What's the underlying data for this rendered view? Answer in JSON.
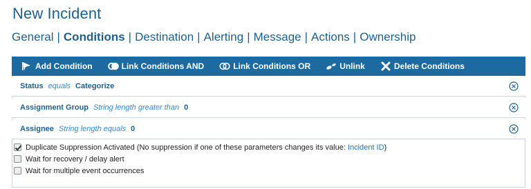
{
  "page": {
    "title": "New Incident"
  },
  "tabs": [
    {
      "label": "General",
      "active": false
    },
    {
      "label": "Conditions",
      "active": true
    },
    {
      "label": "Destination",
      "active": false
    },
    {
      "label": "Alerting",
      "active": false
    },
    {
      "label": "Message",
      "active": false
    },
    {
      "label": "Actions",
      "active": false
    },
    {
      "label": "Ownership",
      "active": false
    }
  ],
  "tab_separator": "|",
  "toolbar": {
    "add": {
      "label": "Add Condition",
      "icon": "flag-arrow-icon"
    },
    "link_and": {
      "label": "Link Conditions AND",
      "icon": "link-and-icon"
    },
    "link_or": {
      "label": "Link Conditions OR",
      "icon": "link-or-icon"
    },
    "unlink": {
      "label": "Unlink",
      "icon": "unlink-icon"
    },
    "delete": {
      "label": "Delete Conditions",
      "icon": "x-icon"
    }
  },
  "conditions": [
    {
      "field": "Status",
      "operator": "equals",
      "value": "Categorize"
    },
    {
      "field": "Assignment Group",
      "operator": "String length greater than",
      "value": "0"
    },
    {
      "field": "Assignee",
      "operator": "String length equals",
      "value": "0"
    }
  ],
  "options": {
    "duplicate_suppression": {
      "checked": true,
      "label": "Duplicate Suppression Activated (No suppression if one of these parameters changes its value: ",
      "link": "Incident ID",
      "suffix": ")"
    },
    "wait_recovery": {
      "checked": false,
      "label": "Wait for recovery / delay alert"
    },
    "wait_multiple": {
      "checked": false,
      "label": "Wait for multiple event occurrences"
    }
  },
  "colors": {
    "accent": "#1d6aa1",
    "title": "#1f5f8b",
    "operator": "#3f86c4"
  }
}
